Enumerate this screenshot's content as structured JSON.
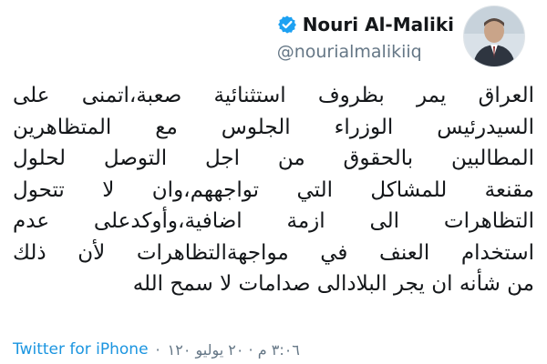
{
  "author": {
    "display_name": "Nouri Al-Maliki",
    "handle": "@nourialmalikiiq",
    "verified_icon": "verified-badge-icon",
    "avatar_icon": "profile-photo",
    "verified_color": "#1da1f2"
  },
  "tweet": {
    "lines": [
      "العراق يمر بظروف استثنائية صعبة،اتمنى على",
      "السيدرئيس الوزراء الجلوس مع المتظاهرين",
      "المطالبين بالحقوق من اجل التوصل لحلول",
      "مقنعة للمشاكل التي تواجههم،وان لا تتحول",
      "التظاهرات الى ازمة اضافية،وأوكدعلى عدم",
      "استخدام العنف في مواجهةالتظاهرات لأن ذلك",
      "من شأنه ان يجر البلادالى صدامات لا سمح الله"
    ]
  },
  "meta": {
    "source": "Twitter for iPhone",
    "separator": "·",
    "timestamp": "٣:٠٦ م · ٢٠ يوليو ١٢٠",
    "link_color": "#1b95e0"
  }
}
